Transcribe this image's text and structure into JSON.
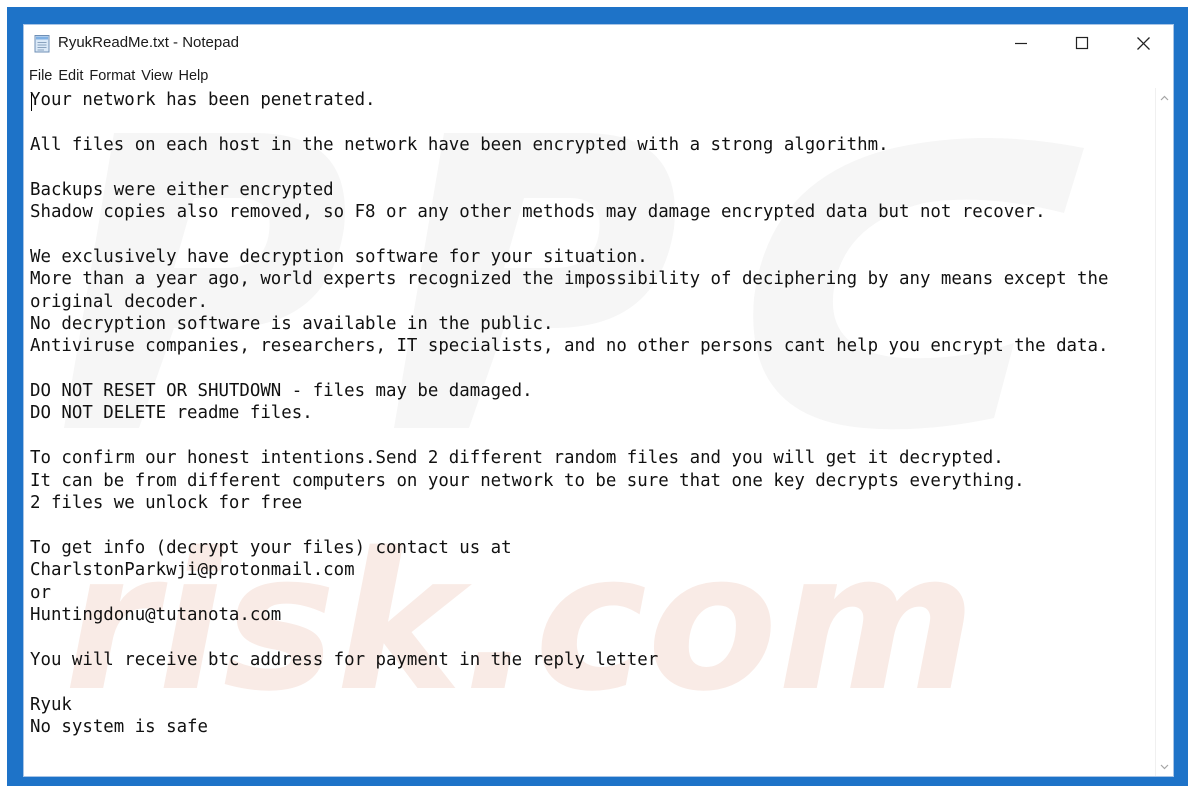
{
  "window": {
    "title": "RyukReadMe.txt - Notepad",
    "controls": {
      "minimize": "minimize",
      "maximize": "maximize",
      "close": "close"
    }
  },
  "menu": [
    "File",
    "Edit",
    "Format",
    "View",
    "Help"
  ],
  "document": {
    "lines": [
      "Your network has been penetrated.",
      "",
      "All files on each host in the network have been encrypted with a strong algorithm.",
      "",
      "Backups were either encrypted",
      "Shadow copies also removed, so F8 or any other methods may damage encrypted data but not recover.",
      "",
      "We exclusively have decryption software for your situation.",
      "More than a year ago, world experts recognized the impossibility of deciphering by any means except the",
      "original decoder.",
      "No decryption software is available in the public.",
      "Antiviruse companies, researchers, IT specialists, and no other persons cant help you encrypt the data.",
      "",
      "DO NOT RESET OR SHUTDOWN - files may be damaged.",
      "DO NOT DELETE readme files.",
      "",
      "To confirm our honest intentions.Send 2 different random files and you will get it decrypted.",
      "It can be from different computers on your network to be sure that one key decrypts everything.",
      "2 files we unlock for free",
      "",
      "To get info (decrypt your files) contact us at",
      "CharlstonParkwji@protonmail.com",
      "or",
      "Huntingdonu@tutanota.com",
      "",
      "You will receive btc address for payment in the reply letter",
      "",
      "Ryuk",
      "No system is safe"
    ]
  },
  "watermark": {
    "text": "risk.com"
  },
  "colors": {
    "frame": "#1e73c8",
    "text": "#111111",
    "watermark": "#f7e7e2"
  },
  "icons": {
    "app": "notepad-icon",
    "minimize": "minimize-icon",
    "maximize": "maximize-icon",
    "close": "close-icon",
    "scroll_up": "chevron-up-icon",
    "scroll_down": "chevron-down-icon"
  }
}
